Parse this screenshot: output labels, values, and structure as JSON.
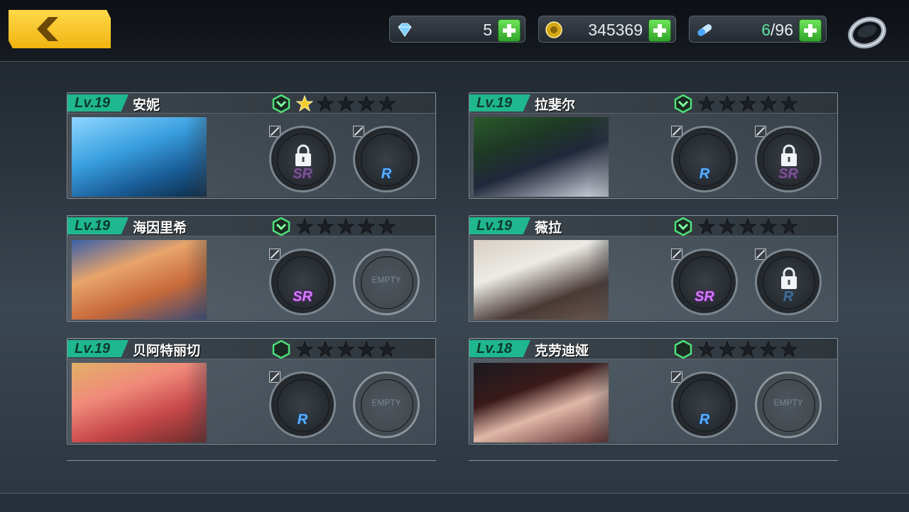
{
  "resources": {
    "gems": "5",
    "gold": "345369",
    "stamina_current": "6",
    "stamina_max": "/96"
  },
  "icons": {
    "back": "back-arrow-icon",
    "gem": "diamond-icon",
    "gold": "gold-coin-icon",
    "stamina": "capsule-icon",
    "plus": "plus-icon",
    "ring": "ring-icon",
    "rank": "rank-chevron-icon",
    "star": "star-icon",
    "lock": "lock-icon",
    "edit": "edit-icon"
  },
  "colors": {
    "level_badge": "#1fb78e",
    "sr": "#d77bff",
    "r": "#5ab0ff",
    "plus": "#3fc23a",
    "back_button": "#f5c21b",
    "star_lit": "#f4cc2a"
  },
  "empty_label": "EMPTY",
  "characters": [
    {
      "level": "Lv.19",
      "name": "安妮",
      "stars_lit": 1,
      "rank": "chevron",
      "slots": [
        {
          "rarity": "SR",
          "locked": true
        },
        {
          "rarity": "R",
          "locked": false
        }
      ]
    },
    {
      "level": "Lv.19",
      "name": "拉斐尔",
      "stars_lit": 0,
      "rank": "chevron",
      "slots": [
        {
          "rarity": "R",
          "locked": false
        },
        {
          "rarity": "SR",
          "locked": true
        }
      ]
    },
    {
      "level": "Lv.19",
      "name": "海因里希",
      "stars_lit": 0,
      "rank": "chevron",
      "slots": [
        {
          "rarity": "SR",
          "locked": false
        },
        {
          "rarity": "",
          "locked": false,
          "empty": true
        }
      ]
    },
    {
      "level": "Lv.19",
      "name": "薇拉",
      "stars_lit": 0,
      "rank": "chevron",
      "slots": [
        {
          "rarity": "SR",
          "locked": false
        },
        {
          "rarity": "R",
          "locked": true
        }
      ]
    },
    {
      "level": "Lv.19",
      "name": "贝阿特丽切",
      "stars_lit": 0,
      "rank": "hex",
      "slots": [
        {
          "rarity": "R",
          "locked": false
        },
        {
          "rarity": "",
          "locked": false,
          "empty": true
        }
      ]
    },
    {
      "level": "Lv.18",
      "name": "克劳迪娅",
      "stars_lit": 0,
      "rank": "hex",
      "slots": [
        {
          "rarity": "R",
          "locked": false
        },
        {
          "rarity": "",
          "locked": false,
          "empty": true
        }
      ]
    }
  ]
}
